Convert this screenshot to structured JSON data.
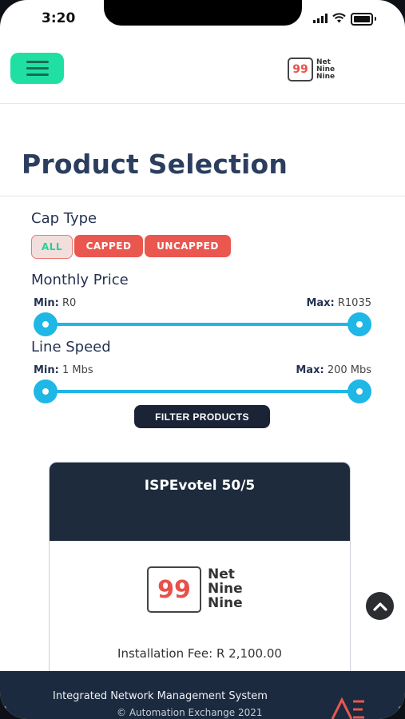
{
  "status_bar": {
    "time": "3:20"
  },
  "header": {
    "menu_icon": "hamburger-icon",
    "brand_badge": "99",
    "brand_lines": [
      "Net",
      "Nine",
      "Nine"
    ]
  },
  "page_title": "Product Selection",
  "filters": {
    "cap_type_label": "Cap Type",
    "cap_types": [
      "ALL",
      "CAPPED",
      "UNCAPPED"
    ],
    "selected_cap_type": "ALL",
    "monthly_price_label": "Monthly Price",
    "price_min_label": "Min:",
    "price_min_value": "R0",
    "price_max_label": "Max:",
    "price_max_value": "R1035",
    "line_speed_label": "Line Speed",
    "speed_min_label": "Min:",
    "speed_min_value": "1 Mbs",
    "speed_max_label": "Max:",
    "speed_max_value": "200 Mbs",
    "filter_button": "FILTER PRODUCTS"
  },
  "product_card": {
    "title": "ISPEvotel 50/5",
    "logo_badge": "99",
    "logo_lines": [
      "Net",
      "Nine",
      "Nine"
    ],
    "installation_fee": "Installation Fee: R 2,100.00"
  },
  "footer": {
    "title": "Integrated Network Management System",
    "copyright": "© Automation Exchange 2021",
    "logo": "AE"
  },
  "colors": {
    "accent_green": "#1fe0a2",
    "accent_red": "#e9574f",
    "slider_blue": "#1eb7e6",
    "navy": "#1d2b3c",
    "title_blue": "#2c3e5f"
  }
}
